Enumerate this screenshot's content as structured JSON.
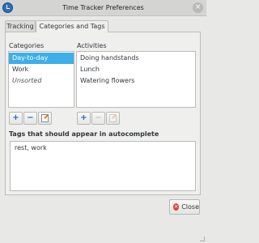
{
  "window": {
    "title": "Time Tracker Preferences",
    "close_glyph": "×"
  },
  "tabs": [
    {
      "label": "Tracking"
    },
    {
      "label": "Categories and Tags"
    }
  ],
  "categories": {
    "header": "Categories",
    "items": [
      {
        "label": "Day-to-day",
        "selected": true
      },
      {
        "label": "Work"
      },
      {
        "label": "Unsorted",
        "italic": true
      }
    ]
  },
  "activities": {
    "header": "Activities",
    "items": [
      {
        "label": "Doing handstands"
      },
      {
        "label": "Lunch"
      },
      {
        "label": "Watering flowers"
      }
    ]
  },
  "buttons": {
    "add_glyph": "+",
    "remove_glyph": "−"
  },
  "tags": {
    "header": "Tags that should appear in autocomplete",
    "value": "rest, work"
  },
  "footer": {
    "close_label": "Close",
    "close_glyph": "×"
  },
  "colors": {
    "selection": "#3daee9",
    "accent_blue": "#2a63b5",
    "close_red": "#d9433a"
  }
}
